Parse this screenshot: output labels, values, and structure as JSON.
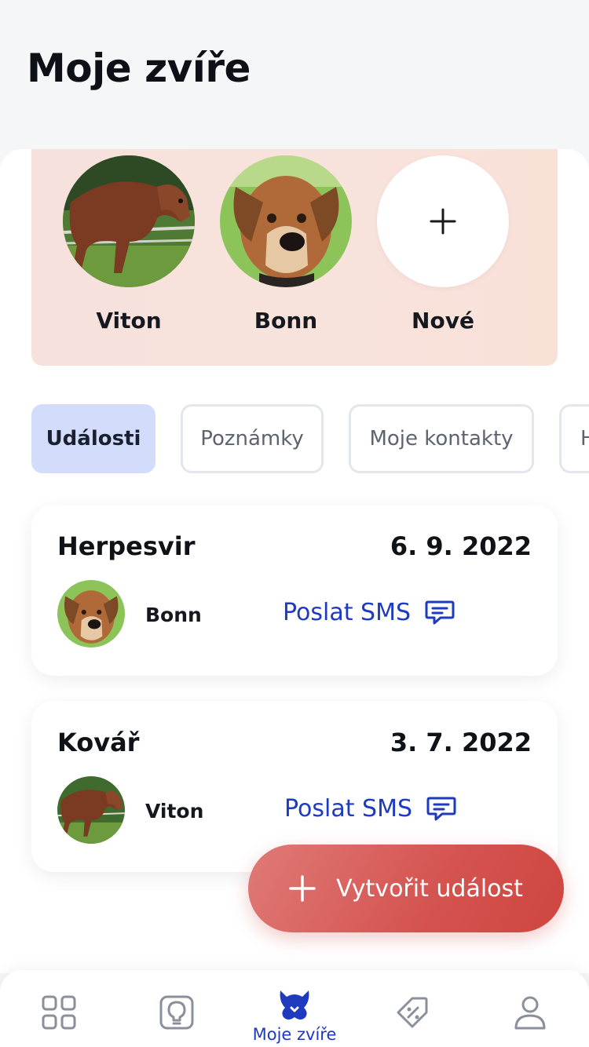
{
  "header": {
    "title": "Moje zvíře"
  },
  "pets": [
    {
      "name": "Viton",
      "kind": "horse"
    },
    {
      "name": "Bonn",
      "kind": "dog"
    },
    {
      "name": "Nové",
      "icon": "plus-icon"
    }
  ],
  "tabs": [
    {
      "label": "Události",
      "active": true
    },
    {
      "label": "Poznámky",
      "active": false
    },
    {
      "label": "Moje kontakty",
      "active": false
    },
    {
      "label": "H",
      "active": false
    }
  ],
  "events": [
    {
      "title": "Herpesvir",
      "date": "6. 9. 2022",
      "pet": "Bonn",
      "action": "Poslat SMS",
      "action_icon": "message-icon"
    },
    {
      "title": "Kovář",
      "date": "3. 7. 2022",
      "pet": "Viton",
      "action": "Poslat SMS",
      "action_icon": "message-icon"
    }
  ],
  "fab": {
    "label": "Vytvořit událost",
    "icon": "plus-icon"
  },
  "bottom_nav": [
    {
      "icon": "grid-icon",
      "label": ""
    },
    {
      "icon": "lightbulb-icon",
      "label": ""
    },
    {
      "icon": "pet-icon",
      "label": "Moje zvíře",
      "active": true
    },
    {
      "icon": "discount-tag-icon",
      "label": ""
    },
    {
      "icon": "user-icon",
      "label": ""
    }
  ],
  "colors": {
    "accent_blue": "#1e3bbf",
    "fab_red": "#d4534f",
    "active_tab_bg": "#d4dcfb",
    "pets_strip_bg": "#f7e1db"
  }
}
